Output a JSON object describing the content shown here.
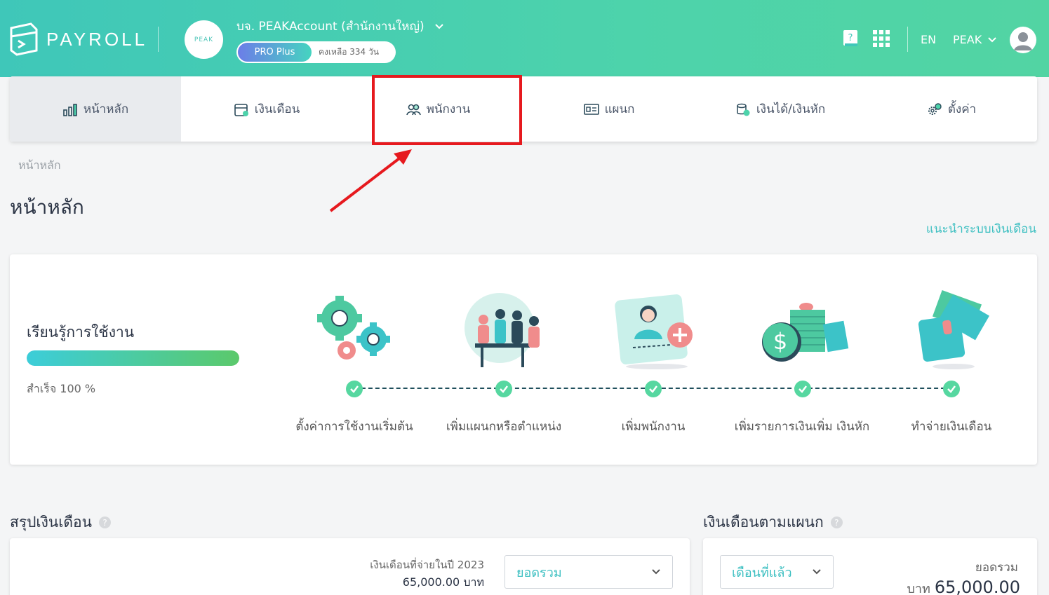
{
  "header": {
    "logo_text": "PAYROLL",
    "company_avatar_text": "PEAK",
    "company_name": "บจ. PEAKAccount (สำนักงานใหญ่)",
    "plan_label": "PRO Plus",
    "plan_remaining": "คงเหลือ 334 วัน",
    "language": "EN",
    "user_name": "PEAK"
  },
  "nav": {
    "items": [
      {
        "label": "หน้าหลัก",
        "icon": "chart-icon"
      },
      {
        "label": "เงินเดือน",
        "icon": "calendar-icon"
      },
      {
        "label": "พนักงาน",
        "icon": "people-icon"
      },
      {
        "label": "แผนก",
        "icon": "id-card-icon"
      },
      {
        "label": "เงินได้/เงินหัก",
        "icon": "coins-icon"
      },
      {
        "label": "ตั้งค่า",
        "icon": "gears-icon"
      }
    ]
  },
  "breadcrumb": "หน้าหลัก",
  "page_title": "หน้าหลัก",
  "guide_link": "แนะนำระบบเงินเดือน",
  "learn": {
    "title": "เรียนรู้การใช้งาน",
    "progress_percent": 100,
    "progress_text": "สำเร็จ 100 %",
    "steps": [
      {
        "label": "ตั้งค่าการใช้งานเริ่มต้น"
      },
      {
        "label": "เพิ่มแผนกหรือตำแหน่ง"
      },
      {
        "label": "เพิ่มพนักงาน"
      },
      {
        "label": "เพิ่มรายการเงินเพิ่ม เงินหัก"
      },
      {
        "label": "ทำจ่ายเงินเดือน"
      }
    ]
  },
  "summary": {
    "title": "สรุปเงินเดือน",
    "paid_label": "เงินเดือนที่จ่ายในปี 2023",
    "paid_value": "65,000.00 บาท",
    "select_value": "ยอดรวม"
  },
  "department": {
    "title": "เงินเดือนตามแผนก",
    "select_value": "เดือนที่แล้ว",
    "total_label": "ยอดรวม",
    "total_currency": "บาท",
    "total_value": "65,000.00"
  },
  "colors": {
    "header_start": "#3fc7b9",
    "header_end": "#52d4a3",
    "accent": "#3cbfc1",
    "highlight": "#e6191e"
  }
}
